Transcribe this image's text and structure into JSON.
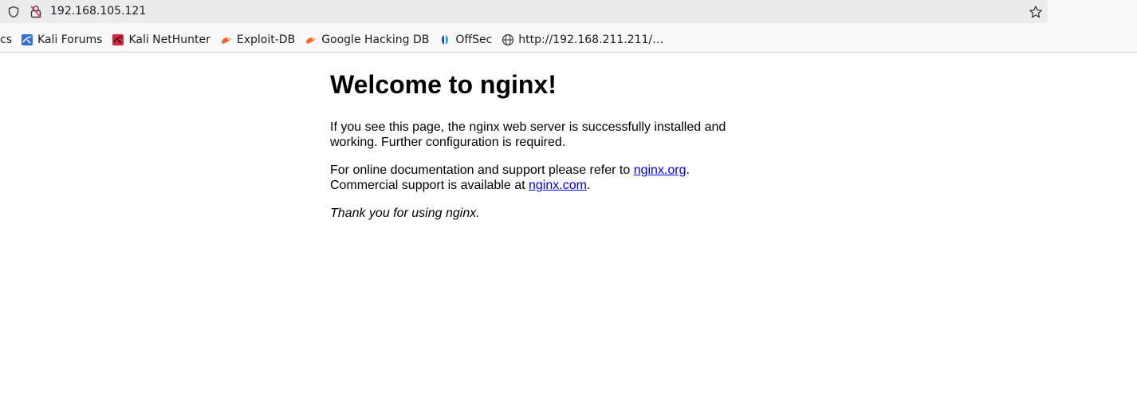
{
  "browser": {
    "url": "192.168.105.121",
    "bookmarks": [
      {
        "label": "cs",
        "icon": "none"
      },
      {
        "label": "Kali Forums",
        "icon": "kali-forums-icon"
      },
      {
        "label": "Kali NetHunter",
        "icon": "kali-nethunter-icon"
      },
      {
        "label": "Exploit-DB",
        "icon": "exploit-db-icon"
      },
      {
        "label": "Google Hacking DB",
        "icon": "ghdb-icon"
      },
      {
        "label": "OffSec",
        "icon": "offsec-icon"
      },
      {
        "label": "http://192.168.211.211/…",
        "icon": "globe-icon"
      }
    ]
  },
  "page": {
    "heading": "Welcome to nginx!",
    "para1": "If you see this page, the nginx web server is successfully installed and working. Further configuration is required.",
    "para2_prefix": "For online documentation and support please refer to ",
    "link_org": "nginx.org",
    "para2_mid": ".",
    "para2_line2_prefix": "Commercial support is available at ",
    "link_com": "nginx.com",
    "para2_end": ".",
    "thanks": "Thank you for using nginx."
  },
  "colors": {
    "link": "#0000ee",
    "toolbar_bg": "#f9f9fb",
    "urlbar_bg": "#ececee"
  }
}
